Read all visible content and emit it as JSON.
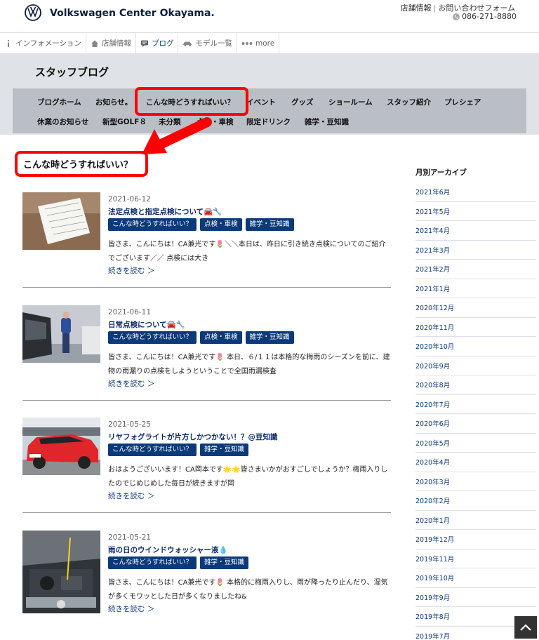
{
  "header": {
    "brand": "Volkswagen Center Okayama.",
    "link_store": "店舗情報",
    "link_contact": "お問い合わせフォーム",
    "phone": "086-271-8880"
  },
  "topnav": [
    {
      "label": "インフォメーション",
      "icon": "info-icon"
    },
    {
      "label": "店舗情報",
      "icon": "home-icon"
    },
    {
      "label": "ブログ",
      "icon": "chat-icon"
    },
    {
      "label": "モデル一覧",
      "icon": "car-icon"
    },
    {
      "label": "more",
      "icon": "dots-icon"
    }
  ],
  "band": {
    "title": "スタッフブログ",
    "categories_row1": [
      "ブログホーム",
      "お知らせ。",
      "こんな時どうすればいい？",
      "イベント",
      "グッズ",
      "ショールーム",
      "スタッフ紹介",
      "プレシェア"
    ],
    "categories_row2": [
      "休業のお知らせ",
      "新型GOLF８",
      "未分類",
      "点検・車検",
      "限定ドリンク",
      "雑学・豆知識"
    ]
  },
  "section_heading": "こんな時どうすればいい？",
  "posts": [
    {
      "date": "2021-06-12",
      "title": "法定点検と指定点検について🚘🔧",
      "tags": [
        "こんな時どうすればいい？",
        "点検・車検",
        "雑学・豆知識"
      ],
      "excerpt": "皆さま、こんにちは！CA兼光です🌷＼＼本日は、昨日に引き続き点検についてのご紹介でございます／／ 点検には大き",
      "readmore": "続きを読む ＞"
    },
    {
      "date": "2021-06-11",
      "title": "日常点検について🚘🔧",
      "tags": [
        "こんな時どうすればいい？",
        "点検・車検",
        "雑学・豆知識"
      ],
      "excerpt": "皆さま、こんにちは！CA兼光です🌷 本日、６/１１は本格的な梅雨のシーズンを前に、建物の雨漏りの点検をしようということで全国雨漏検査",
      "readmore": "続きを読む ＞"
    },
    {
      "date": "2021-05-25",
      "title": "リヤフォグライトが片方しかつかない！？@豆知識",
      "tags": [
        "こんな時どうすればいい？",
        "雑学・豆知識"
      ],
      "excerpt": "おはようございいます！CA岡本です🌟🌟皆さまいかがおすごしでしょうか？梅雨入りしたのでじめじめした毎日が続きますが岡",
      "readmore": "続きを読む ＞"
    },
    {
      "date": "2021-05-21",
      "title": "雨の日のウインドウォッシャー液💧",
      "tags": [
        "こんな時どうすればいい？",
        "雑学・豆知識"
      ],
      "excerpt": "皆さま、こんにちは！CA兼光です🌷 本格的に梅雨入りし、雨が降ったり止んだり、湿気が多くモワッとした日が多くなりましたね&",
      "readmore": "続きを読む ＞"
    }
  ],
  "sidebar": {
    "title": "月別アーカイブ",
    "archives": [
      "2021年6月",
      "2021年5月",
      "2021年4月",
      "2021年3月",
      "2021年2月",
      "2021年1月",
      "2020年12月",
      "2020年11月",
      "2020年10月",
      "2020年9月",
      "2020年8月",
      "2020年7月",
      "2020年6月",
      "2020年5月",
      "2020年4月",
      "2020年3月",
      "2020年2月",
      "2020年1月",
      "2019年12月",
      "2019年11月",
      "2019年10月",
      "2019年9月",
      "2019年8月",
      "2019年7月"
    ]
  },
  "colors": {
    "highlight": "#ff0000",
    "tag_bg": "#0b3a7a",
    "band_bg": "#dfe3e7",
    "catnav_bg": "#b9bfc5"
  }
}
